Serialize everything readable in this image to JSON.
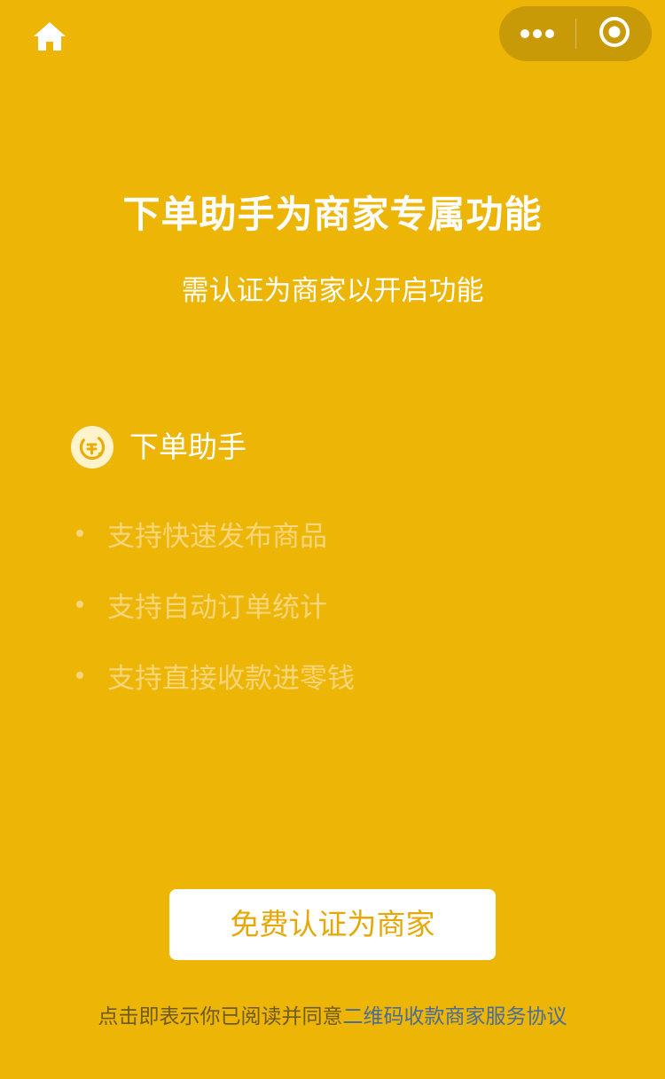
{
  "colors": {
    "background": "#EDB506",
    "capsule": "#C99A07",
    "button_text": "#E6A807",
    "link": "#4A6D96",
    "muted_point": "#F7D67A"
  },
  "nav": {
    "home_icon": "home-icon",
    "more_icon": "more-dots-icon",
    "close_icon": "close-circle-icon"
  },
  "header": {
    "title": "下单助手为商家专属功能",
    "subtitle": "需认证为商家以开启功能"
  },
  "feature": {
    "icon": "order-assistant-icon",
    "name": "下单助手",
    "points": [
      "支持快速发布商品",
      "支持自动订单统计",
      "支持直接收款进零钱"
    ]
  },
  "cta": {
    "label": "免费认证为商家"
  },
  "agreement": {
    "prefix": "点击即表示你已阅读并同意",
    "link": "二维码收款商家服务协议"
  }
}
